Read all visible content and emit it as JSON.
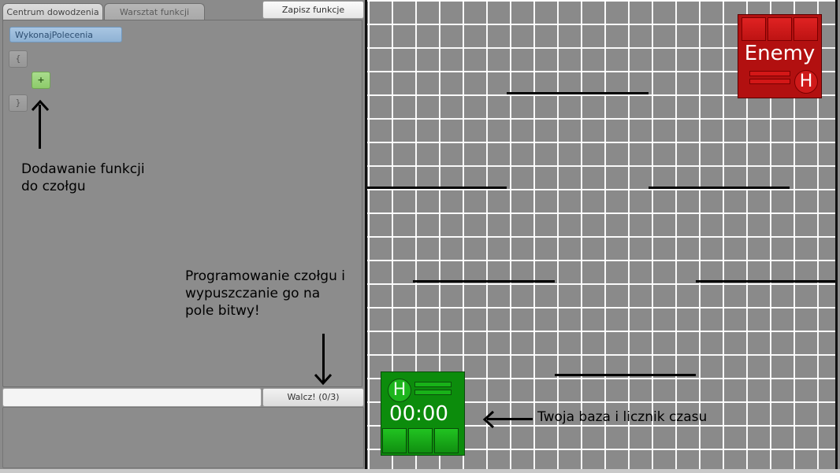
{
  "tabs": [
    {
      "label": "Centrum dowodzenia",
      "active": true
    },
    {
      "label": "Warsztat funkcji",
      "active": false
    }
  ],
  "toolbar": {
    "save_label": "Zapisz funkcje"
  },
  "editor": {
    "function_name": "WykonajPolecenia",
    "brace_open": "{",
    "brace_close": "}",
    "add_label": "+"
  },
  "annotations": {
    "add_functions": "Dodawanie funkcji\ndo czołgu",
    "programming": "Programowanie czołgu i\nwypuszczanie go na\npole bitwy!",
    "base_timer": "Twoja baza i licznik czasu"
  },
  "status_bar": {
    "text": ""
  },
  "fight_button": {
    "label": "Walcz! (0/3)"
  },
  "battlefield": {
    "enemy_base": {
      "label": "Enemy",
      "badge": "H",
      "color": "#b21010"
    },
    "player_base": {
      "badge": "H",
      "timer": "00:00",
      "color": "#0c8c0c"
    }
  }
}
